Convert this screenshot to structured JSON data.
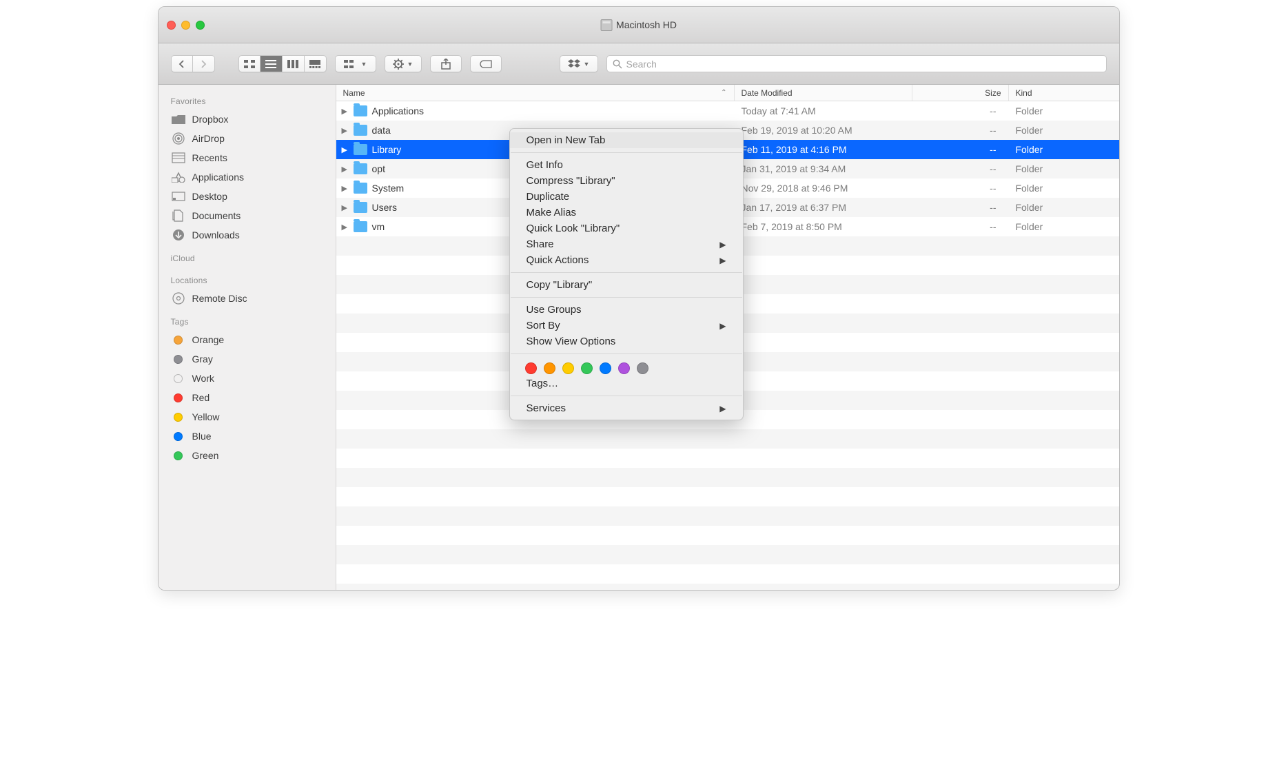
{
  "window": {
    "title": "Macintosh HD"
  },
  "toolbar": {
    "search_placeholder": "Search"
  },
  "sidebar": {
    "sections": {
      "favorites": {
        "title": "Favorites",
        "items": [
          "Dropbox",
          "AirDrop",
          "Recents",
          "Applications",
          "Desktop",
          "Documents",
          "Downloads"
        ]
      },
      "icloud": {
        "title": "iCloud",
        "items": []
      },
      "locations": {
        "title": "Locations",
        "items": [
          "Remote Disc"
        ]
      },
      "tags": {
        "title": "Tags",
        "items": [
          {
            "label": "Orange",
            "color": "#f6a43a"
          },
          {
            "label": "Gray",
            "color": "#8e8e93"
          },
          {
            "label": "Work",
            "color": null
          },
          {
            "label": "Red",
            "color": "#ff3b30"
          },
          {
            "label": "Yellow",
            "color": "#ffcc00"
          },
          {
            "label": "Blue",
            "color": "#007aff"
          },
          {
            "label": "Green",
            "color": "#34c759"
          }
        ]
      }
    }
  },
  "columns": {
    "name": "Name",
    "date": "Date Modified",
    "size": "Size",
    "kind": "Kind"
  },
  "files": [
    {
      "name": "Applications",
      "date": "Today at 7:41 AM",
      "size": "--",
      "kind": "Folder",
      "selected": false
    },
    {
      "name": "data",
      "date": "Feb 19, 2019 at 10:20 AM",
      "size": "--",
      "kind": "Folder",
      "selected": false
    },
    {
      "name": "Library",
      "date": "Feb 11, 2019 at 4:16 PM",
      "size": "--",
      "kind": "Folder",
      "selected": true
    },
    {
      "name": "opt",
      "date": "Jan 31, 2019 at 9:34 AM",
      "size": "--",
      "kind": "Folder",
      "selected": false
    },
    {
      "name": "System",
      "date": "Nov 29, 2018 at 9:46 PM",
      "size": "--",
      "kind": "Folder",
      "selected": false
    },
    {
      "name": "Users",
      "date": "Jan 17, 2019 at 6:37 PM",
      "size": "--",
      "kind": "Folder",
      "selected": false
    },
    {
      "name": "vm",
      "date": "Feb 7, 2019 at 8:50 PM",
      "size": "--",
      "kind": "Folder",
      "selected": false
    }
  ],
  "context_menu": {
    "groups": [
      [
        {
          "label": "Open in New Tab",
          "arrow": false,
          "highlight": true
        }
      ],
      [
        {
          "label": "Get Info",
          "arrow": false
        },
        {
          "label": "Compress \"Library\"",
          "arrow": false
        },
        {
          "label": "Duplicate",
          "arrow": false
        },
        {
          "label": "Make Alias",
          "arrow": false
        },
        {
          "label": "Quick Look \"Library\"",
          "arrow": false
        },
        {
          "label": "Share",
          "arrow": true
        },
        {
          "label": "Quick Actions",
          "arrow": true
        }
      ],
      [
        {
          "label": "Copy \"Library\"",
          "arrow": false
        }
      ],
      [
        {
          "label": "Use Groups",
          "arrow": false
        },
        {
          "label": "Sort By",
          "arrow": true
        },
        {
          "label": "Show View Options",
          "arrow": false
        }
      ]
    ],
    "tag_colors": [
      "#ff3b30",
      "#ff9500",
      "#ffcc00",
      "#34c759",
      "#007aff",
      "#af52de",
      "#8e8e93"
    ],
    "tags_label": "Tags…",
    "services": {
      "label": "Services",
      "arrow": true
    }
  }
}
